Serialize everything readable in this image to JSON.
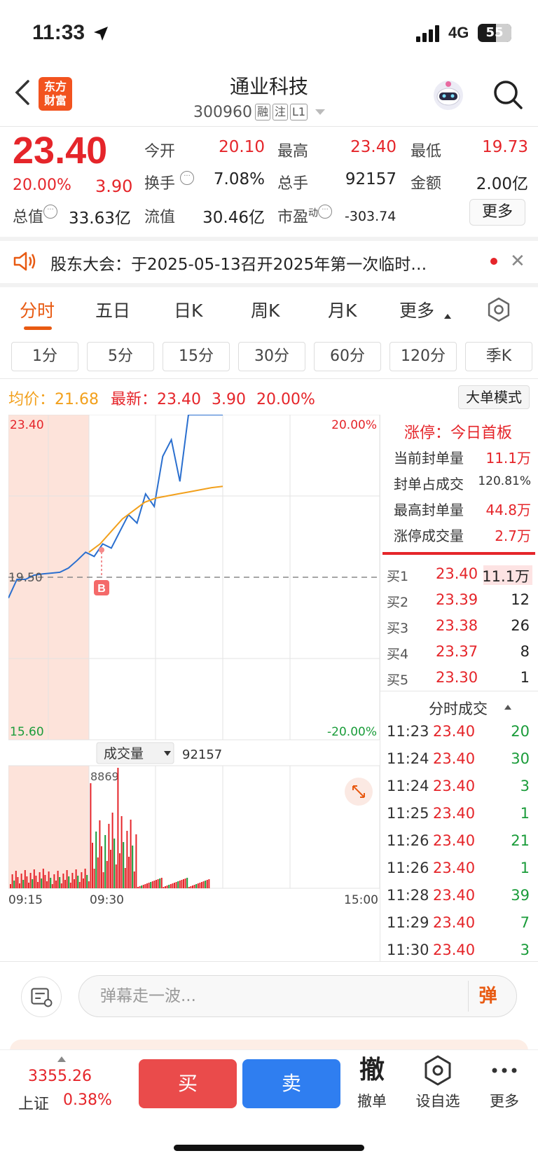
{
  "status": {
    "time": "11:33",
    "network": "4G",
    "battery": "55",
    "battery_level": 0.55
  },
  "header": {
    "logo_text": "东方\n财富",
    "stock_name": "通业科技",
    "stock_code": "300960",
    "tags": [
      "融",
      "注",
      "L1"
    ]
  },
  "quote": {
    "price": "23.40",
    "change_pct": "20.00%",
    "change": "3.90",
    "open_label": "今开",
    "open": "20.10",
    "high_label": "最高",
    "high": "23.40",
    "low_label": "最低",
    "low": "19.73",
    "turnover_label": "换手",
    "turnover": "7.08%",
    "volume_label": "总手",
    "volume": "92157",
    "amount_label": "金额",
    "amount": "2.00亿",
    "mktcap_label": "总值",
    "mktcap": "33.63亿",
    "float_label": "流值",
    "float_cap": "30.46亿",
    "pe_label": "市盈",
    "pe_sup": "动",
    "pe": "-303.74",
    "more_label": "更多"
  },
  "notice": {
    "text": "股东大会：于2025-05-13召开2025年第一次临时…"
  },
  "tabs": [
    "分时",
    "五日",
    "日K",
    "周K",
    "月K",
    "更多"
  ],
  "intervals": [
    "1分",
    "5分",
    "15分",
    "30分",
    "60分",
    "120分",
    "季K"
  ],
  "chart_header": {
    "avg_label": "均价：",
    "avg": "21.68",
    "latest_label": "最新：",
    "latest": "23.40",
    "change": "3.90",
    "pct": "20.00%",
    "big_order_label": "大单模式"
  },
  "chart_data": {
    "type": "line",
    "y_top": "23.40",
    "y_mid": "19.50",
    "y_bottom": "15.60",
    "pct_top": "20.00%",
    "pct_bottom": "-20.00%",
    "ylim": [
      15.6,
      23.4
    ],
    "prev_close": 19.5,
    "x_ticks": [
      "09:15",
      "09:30",
      "15:00"
    ],
    "series": [
      {
        "values": [
          19.0,
          19.45,
          19.45,
          19.55,
          19.58,
          19.6,
          19.62,
          19.72,
          19.9,
          20.1,
          20.0,
          20.3,
          20.2,
          20.6,
          21.0,
          20.8,
          21.5,
          21.2,
          22.4,
          22.8,
          21.8,
          23.4,
          23.4,
          23.4,
          23.4,
          23.4
        ]
      },
      {
        "values": [
          20.1,
          20.3,
          20.6,
          20.9,
          21.1,
          21.3,
          21.4,
          21.45,
          21.5,
          21.55,
          21.6,
          21.65,
          21.68
        ]
      }
    ],
    "volume_label": "成交量",
    "volume_total": "92157",
    "volume_peak": "8869",
    "marker_label": "B"
  },
  "limit_up": {
    "title": "涨停：今日首板",
    "rows": [
      {
        "label": "当前封单量",
        "value": "11.1万"
      },
      {
        "label": "封单占成交",
        "value": "120.81%"
      },
      {
        "label": "最高封单量",
        "value": "44.8万"
      },
      {
        "label": "涨停成交量",
        "value": "2.7万"
      }
    ]
  },
  "order_book": [
    {
      "label": "买1",
      "price": "23.40",
      "qty": "11.1万"
    },
    {
      "label": "买2",
      "price": "23.39",
      "qty": "12"
    },
    {
      "label": "买3",
      "price": "23.38",
      "qty": "26"
    },
    {
      "label": "买4",
      "price": "23.37",
      "qty": "8"
    },
    {
      "label": "买5",
      "price": "23.30",
      "qty": "1"
    }
  ],
  "trades": {
    "title": "分时成交",
    "rows": [
      {
        "time": "11:23",
        "price": "23.40",
        "qty": "20"
      },
      {
        "time": "11:24",
        "price": "23.40",
        "qty": "30"
      },
      {
        "time": "11:24",
        "price": "23.40",
        "qty": "3"
      },
      {
        "time": "11:25",
        "price": "23.40",
        "qty": "1"
      },
      {
        "time": "11:26",
        "price": "23.40",
        "qty": "21"
      },
      {
        "time": "11:26",
        "price": "23.40",
        "qty": "1"
      },
      {
        "time": "11:28",
        "price": "23.40",
        "qty": "39"
      },
      {
        "time": "11:29",
        "price": "23.40",
        "qty": "7"
      },
      {
        "time": "11:30",
        "price": "23.40",
        "qty": "3"
      }
    ]
  },
  "comment": {
    "placeholder": "弹幕走一波...",
    "danmu": "弹"
  },
  "toolbar": {
    "index_value": "3355.26",
    "index_name": "上证",
    "index_pct": "0.38%",
    "buy": "买",
    "sell": "卖",
    "cancel_glyph": "撤",
    "cancel": "撤单",
    "watch": "设自选",
    "more": "更多"
  }
}
